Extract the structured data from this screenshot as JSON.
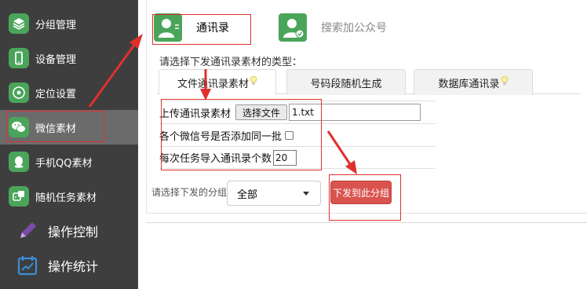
{
  "sidebar": {
    "items": [
      {
        "label": "分组管理",
        "icon": "layers-icon"
      },
      {
        "label": "设备管理",
        "icon": "phone-icon"
      },
      {
        "label": "定位设置",
        "icon": "location-icon"
      },
      {
        "label": "微信素材",
        "icon": "wechat-icon",
        "active": true
      },
      {
        "label": "手机QQ素材",
        "icon": "qq-icon"
      },
      {
        "label": "随机任务素材",
        "icon": "dice-icon"
      },
      {
        "label": "操作控制",
        "icon": "pencil-icon"
      },
      {
        "label": "操作统计",
        "icon": "chart-calendar-icon"
      }
    ]
  },
  "top_tabs": {
    "contacts": "通讯录",
    "search_official": "搜索加公众号"
  },
  "material": {
    "hint": "请选择下发通讯录素材的类型：",
    "tabs": [
      "文件通讯录素材",
      "号码段随机生成",
      "数据库通讯录"
    ]
  },
  "form": {
    "upload_label": "上传通讯录素材",
    "choose_file": "选择文件",
    "file_name": "1.txt",
    "same_batch_label": "各个微信号是否添加同一批",
    "per_task_label": "每次任务导入通讯录个数",
    "per_task_value": "20"
  },
  "footer": {
    "group_label": "请选择下发的分组",
    "group_value": "全部",
    "send_button": "下发到此分组"
  },
  "colors": {
    "sidebar_bg": "#3e3e3e",
    "accent_green": "#4aa55a",
    "send_red": "#d9534f",
    "annotation_red": "#e0302e"
  }
}
